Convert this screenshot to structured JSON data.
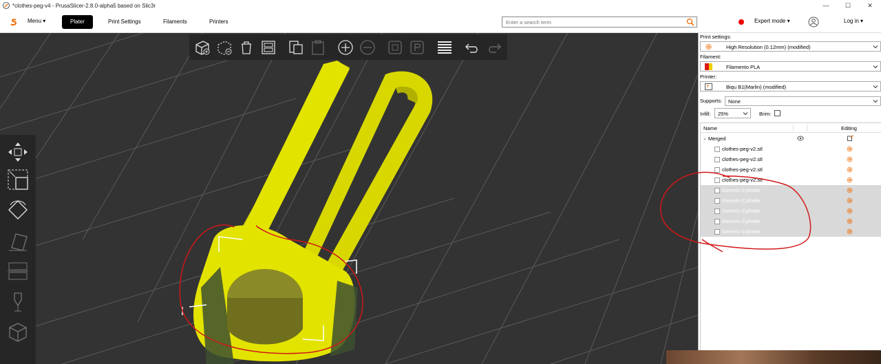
{
  "window": {
    "title": "*clothes-peg-v4 - PrusaSlicer-2.8.0-alpha5 based on Slic3r",
    "controls": [
      "—",
      "☐",
      "✕"
    ]
  },
  "topbar": {
    "menu_label": "Menu ▾",
    "tabs": [
      "Plater",
      "Print Settings",
      "Filaments",
      "Printers"
    ],
    "active_tab": "Plater",
    "search_placeholder": "Enter a search term",
    "mode_label": "Expert mode ▾",
    "mode_color": "#e00000",
    "login_label": "Log in ▾"
  },
  "right_panel": {
    "print_settings_label": "Print settings:",
    "print_settings_value": "High Resolution (0.12mm) (modified)",
    "filament_label": "Filament:",
    "filament_value": "Filamento PLA",
    "printer_label": "Printer:",
    "printer_value": "Biqu B1(Marlin) (modified)",
    "supports_label": "Supports:",
    "supports_value": "None",
    "infill_label": "Infill:",
    "infill_value": "25%",
    "brim_label": "Brim:",
    "brim_checked": false,
    "list_header_name": "Name",
    "list_header_editing": "Editing",
    "objects": [
      {
        "label": "Merged",
        "level": 0,
        "selected": false
      },
      {
        "label": "clothes-peg-v2.stl",
        "level": 1,
        "selected": false
      },
      {
        "label": "clothes-peg-v2.stl",
        "level": 1,
        "selected": false
      },
      {
        "label": "clothes-peg-v2.stl",
        "level": 1,
        "selected": false
      },
      {
        "label": "clothes-peg-v2.stl",
        "level": 1,
        "selected": false
      },
      {
        "label": "Generic-Cylinder",
        "level": 1,
        "selected": true
      },
      {
        "label": "Generic-Cylinder",
        "level": 1,
        "selected": true
      },
      {
        "label": "Generic-Cylinder",
        "level": 1,
        "selected": true
      },
      {
        "label": "Generic-Cylinder",
        "level": 1,
        "selected": true
      },
      {
        "label": "Generic-Cylinder",
        "level": 1,
        "selected": true
      }
    ]
  },
  "colors": {
    "model": "#e3e300",
    "viewport_bg": "#333333",
    "annotation": "#d01818"
  }
}
